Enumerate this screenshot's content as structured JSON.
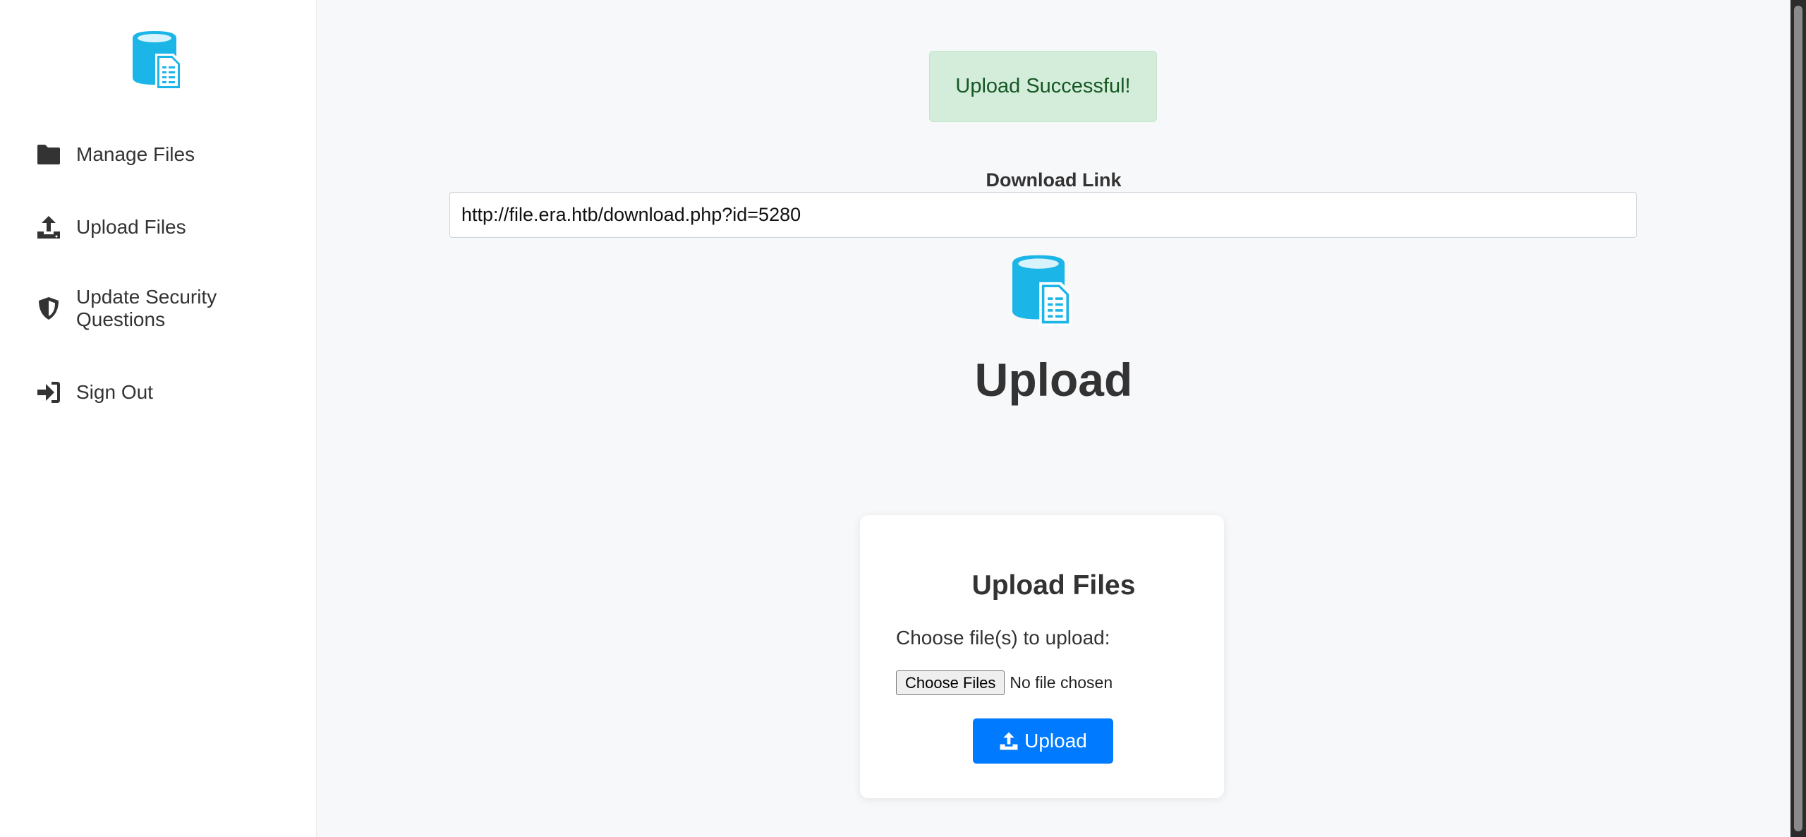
{
  "sidebar": {
    "logo_icon": "database-document-icon",
    "items": [
      {
        "label": "Manage Files",
        "icon": "folder-icon"
      },
      {
        "label": "Upload Files",
        "icon": "upload-icon"
      },
      {
        "label": "Update Security Questions",
        "icon": "shield-icon"
      },
      {
        "label": "Sign Out",
        "icon": "sign-out-icon"
      }
    ]
  },
  "main": {
    "alert": "Upload Successful!",
    "download_label": "Download Link",
    "download_url": "http://file.era.htb/download.php?id=5280",
    "page_title": "Upload",
    "card": {
      "title": "Upload Files",
      "choose_label": "Choose file(s) to upload:",
      "file_button": "Choose Files",
      "file_status": "No file chosen",
      "upload_button": "Upload"
    }
  },
  "colors": {
    "accent": "#007bff",
    "logo": "#1bb5e8",
    "success_bg": "#d4edda",
    "success_text": "#155724"
  }
}
